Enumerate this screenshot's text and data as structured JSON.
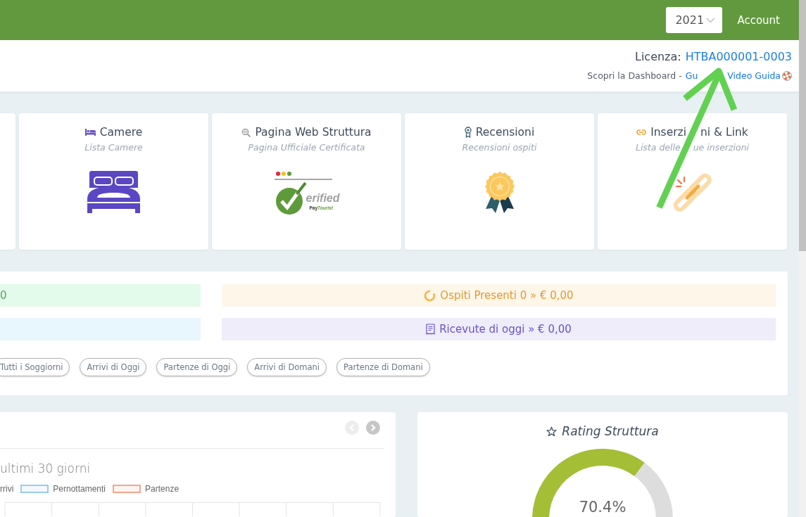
{
  "topbar": {
    "year_select": {
      "value": "2021"
    },
    "account_link": "Account"
  },
  "license_header": {
    "label": "Licenza:",
    "code": "HTBA000001-0003",
    "intro": "Scopri la Dashboard -",
    "links": [
      "Gu",
      "Video Guida"
    ]
  },
  "cards": [
    {
      "kind": "blank"
    },
    {
      "kind": "rooms",
      "title": [
        "Camere"
      ],
      "subtitle": [
        "Lista Camere"
      ]
    },
    {
      "kind": "webpage",
      "title": [
        "Pagina Web Struttura"
      ],
      "subtitle": [
        "Pagina Ufficiale Certificata"
      ],
      "badge": {
        "word": "erified",
        "brand": [
          "Pay",
          "Tourist"
        ]
      }
    },
    {
      "kind": "reviews",
      "title": [
        "Recensioni"
      ],
      "subtitle": [
        "Recensioni ospiti"
      ]
    },
    {
      "kind": "listings",
      "title": [
        "Inserzi",
        "ni & Link"
      ],
      "subtitle": [
        "Lista delle",
        "ue inserzioni"
      ]
    }
  ],
  "summary_panel": {
    "tiles": [
      {
        "kind": "success",
        "text": "0"
      },
      {
        "kind": "warning",
        "text": "Ospiti Presenti 0 » € 0,00"
      },
      {
        "kind": "info"
      },
      {
        "kind": "primary",
        "text": "Ricevute di oggi » € 0,00"
      }
    ],
    "filters": [
      "Tutti i Soggiorni",
      "Arrivi di Oggi",
      "Partenze di Oggi",
      "Arrivi di Domani",
      "Partenze di Domani"
    ]
  },
  "chart_card": {
    "nav": [
      {
        "kind": "prev",
        "disabled": true
      },
      {
        "kind": "next",
        "disabled": false
      }
    ],
    "title": "ultimi 30 giorni",
    "legend": [
      {
        "label": "rrivi"
      },
      {
        "label": "Pernottamenti",
        "color": "#9ccaeb"
      },
      {
        "label": "Partenze",
        "color": "#f2a58f"
      }
    ]
  },
  "rating_card": {
    "title": "Rating Struttura",
    "reading": "70.4%",
    "chart_data": {
      "type": "donut",
      "values": [
        70.4,
        29.6
      ]
    }
  },
  "annotation": {
    "kind": "arrow"
  }
}
